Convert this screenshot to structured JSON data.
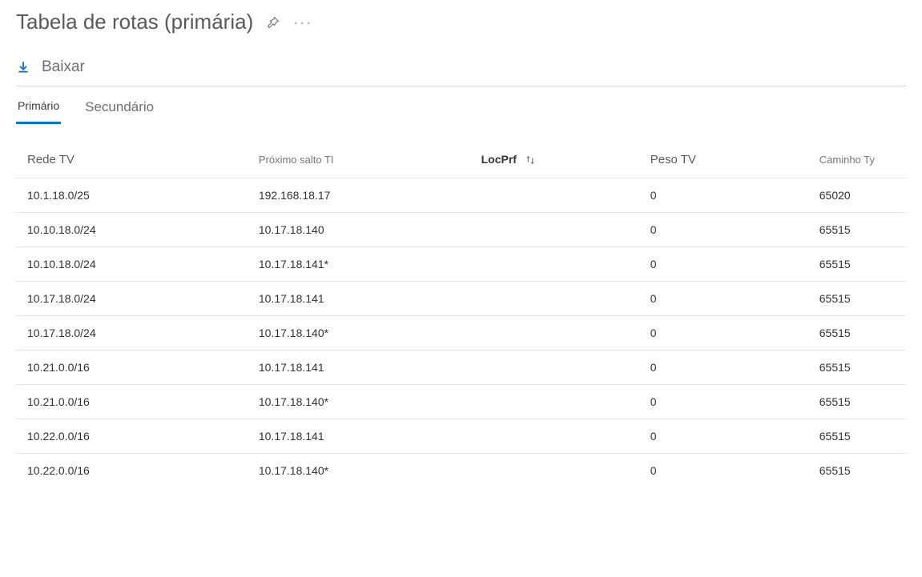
{
  "header": {
    "title": "Tabela de rotas (primária)"
  },
  "toolbar": {
    "download_label": "Baixar"
  },
  "tabs": {
    "primary": "Primário",
    "secondary": "Secundário"
  },
  "table": {
    "columns": {
      "rede": "Rede TV",
      "nexthop": "Próximo salto TI",
      "locprf": "LocPrf",
      "peso": "Peso TV",
      "path": "Caminho Ty"
    },
    "rows": [
      {
        "rede": "10.1.18.0/25",
        "nexthop": "192.168.18.17",
        "locprf": "",
        "peso": "0",
        "path": "65020"
      },
      {
        "rede": "10.10.18.0/24",
        "nexthop": "10.17.18.140",
        "locprf": "",
        "peso": "0",
        "path": "65515"
      },
      {
        "rede": "10.10.18.0/24",
        "nexthop": "10.17.18.141*",
        "locprf": "",
        "peso": "0",
        "path": "65515"
      },
      {
        "rede": "10.17.18.0/24",
        "nexthop": "10.17.18.141",
        "locprf": "",
        "peso": "0",
        "path": "65515"
      },
      {
        "rede": "10.17.18.0/24",
        "nexthop": "10.17.18.140*",
        "locprf": "",
        "peso": "0",
        "path": "65515"
      },
      {
        "rede": "10.21.0.0/16",
        "nexthop": "10.17.18.141",
        "locprf": "",
        "peso": "0",
        "path": "65515"
      },
      {
        "rede": "10.21.0.0/16",
        "nexthop": "10.17.18.140*",
        "locprf": "",
        "peso": "0",
        "path": "65515"
      },
      {
        "rede": "10.22.0.0/16",
        "nexthop": "10.17.18.141",
        "locprf": "",
        "peso": "0",
        "path": "65515"
      },
      {
        "rede": "10.22.0.0/16",
        "nexthop": "10.17.18.140*",
        "locprf": "",
        "peso": "0",
        "path": "65515"
      }
    ]
  }
}
